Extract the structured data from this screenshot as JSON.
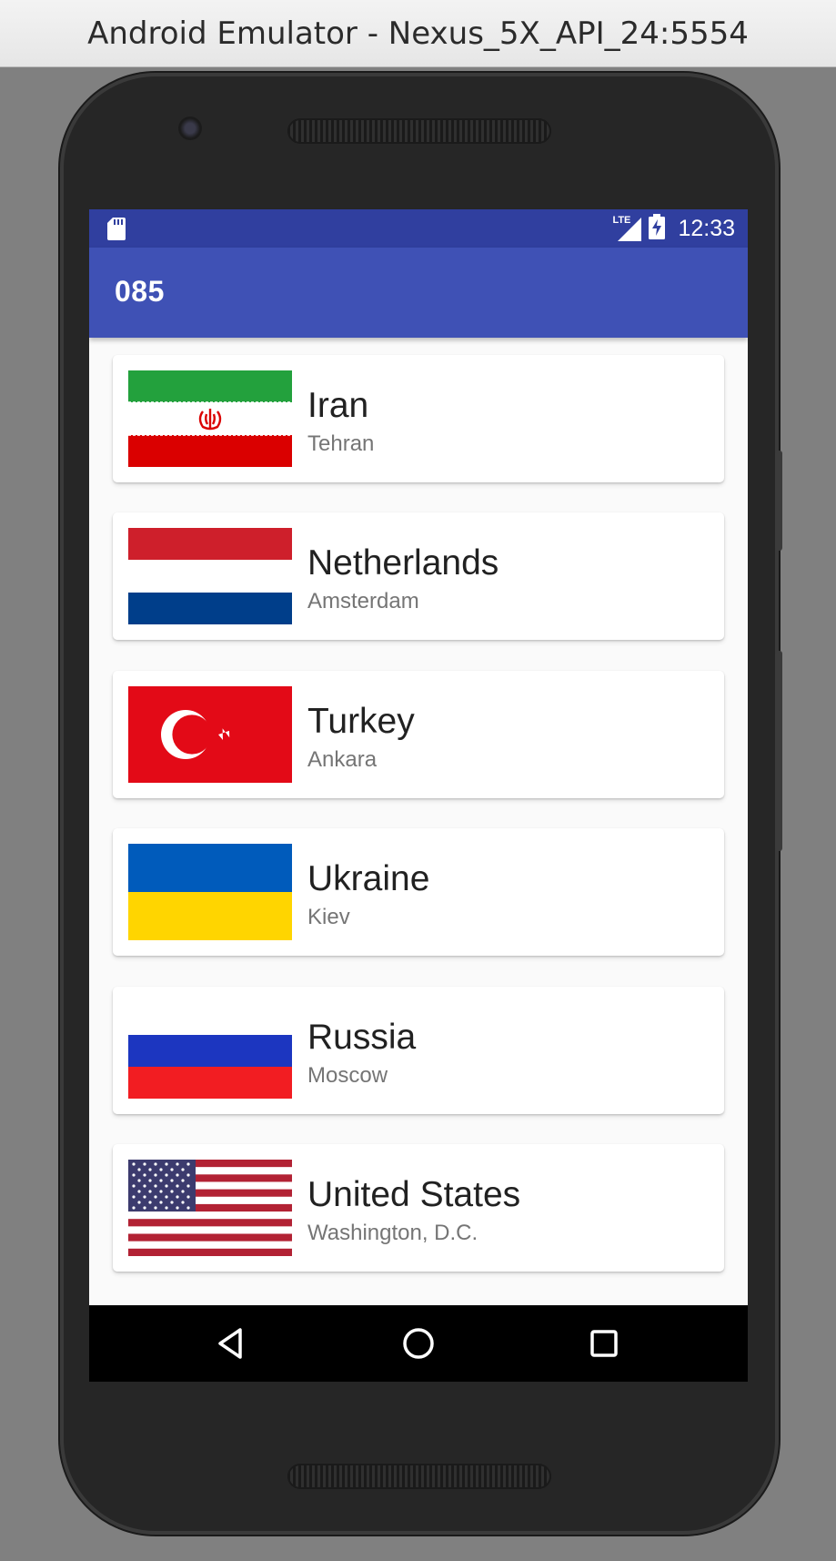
{
  "window": {
    "title": "Android Emulator - Nexus_5X_API_24:5554"
  },
  "status_bar": {
    "time": "12:33",
    "network_label": "LTE",
    "icons": [
      "sd-card-icon",
      "lte-signal-icon",
      "battery-charging-icon"
    ]
  },
  "app_bar": {
    "title": "085"
  },
  "countries": [
    {
      "name": "Iran",
      "capital": "Tehran",
      "flag": "iran-flag"
    },
    {
      "name": "Netherlands",
      "capital": "Amsterdam",
      "flag": "netherlands-flag"
    },
    {
      "name": "Turkey",
      "capital": "Ankara",
      "flag": "turkey-flag"
    },
    {
      "name": "Ukraine",
      "capital": "Kiev",
      "flag": "ukraine-flag"
    },
    {
      "name": "Russia",
      "capital": "Moscow",
      "flag": "russia-flag"
    },
    {
      "name": "United States",
      "capital": "Washington, D.C.",
      "flag": "united-states-flag"
    }
  ],
  "nav_bar": {
    "buttons": [
      "back-icon",
      "home-icon",
      "recents-icon"
    ]
  },
  "colors": {
    "status_bar": "#303f9f",
    "app_bar": "#3f51b5",
    "list_background": "#fafafa"
  }
}
